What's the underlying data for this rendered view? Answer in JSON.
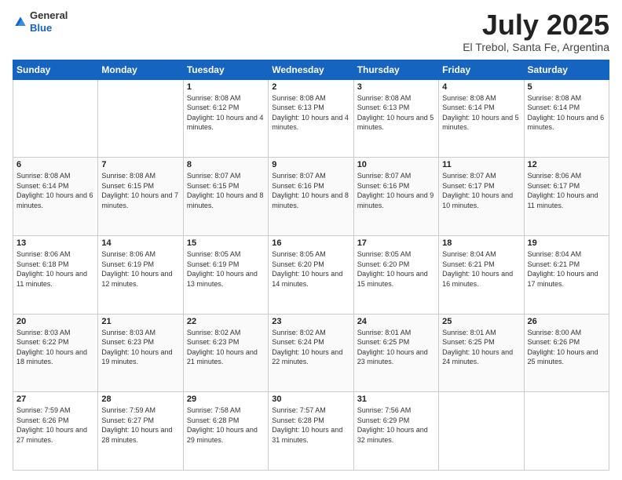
{
  "header": {
    "logo_line1": "General",
    "logo_line2": "Blue",
    "title": "July 2025",
    "location": "El Trebol, Santa Fe, Argentina"
  },
  "columns": [
    "Sunday",
    "Monday",
    "Tuesday",
    "Wednesday",
    "Thursday",
    "Friday",
    "Saturday"
  ],
  "weeks": [
    [
      {
        "day": "",
        "info": ""
      },
      {
        "day": "",
        "info": ""
      },
      {
        "day": "1",
        "info": "Sunrise: 8:08 AM\nSunset: 6:12 PM\nDaylight: 10 hours and 4 minutes."
      },
      {
        "day": "2",
        "info": "Sunrise: 8:08 AM\nSunset: 6:13 PM\nDaylight: 10 hours and 4 minutes."
      },
      {
        "day": "3",
        "info": "Sunrise: 8:08 AM\nSunset: 6:13 PM\nDaylight: 10 hours and 5 minutes."
      },
      {
        "day": "4",
        "info": "Sunrise: 8:08 AM\nSunset: 6:14 PM\nDaylight: 10 hours and 5 minutes."
      },
      {
        "day": "5",
        "info": "Sunrise: 8:08 AM\nSunset: 6:14 PM\nDaylight: 10 hours and 6 minutes."
      }
    ],
    [
      {
        "day": "6",
        "info": "Sunrise: 8:08 AM\nSunset: 6:14 PM\nDaylight: 10 hours and 6 minutes."
      },
      {
        "day": "7",
        "info": "Sunrise: 8:08 AM\nSunset: 6:15 PM\nDaylight: 10 hours and 7 minutes."
      },
      {
        "day": "8",
        "info": "Sunrise: 8:07 AM\nSunset: 6:15 PM\nDaylight: 10 hours and 8 minutes."
      },
      {
        "day": "9",
        "info": "Sunrise: 8:07 AM\nSunset: 6:16 PM\nDaylight: 10 hours and 8 minutes."
      },
      {
        "day": "10",
        "info": "Sunrise: 8:07 AM\nSunset: 6:16 PM\nDaylight: 10 hours and 9 minutes."
      },
      {
        "day": "11",
        "info": "Sunrise: 8:07 AM\nSunset: 6:17 PM\nDaylight: 10 hours and 10 minutes."
      },
      {
        "day": "12",
        "info": "Sunrise: 8:06 AM\nSunset: 6:17 PM\nDaylight: 10 hours and 11 minutes."
      }
    ],
    [
      {
        "day": "13",
        "info": "Sunrise: 8:06 AM\nSunset: 6:18 PM\nDaylight: 10 hours and 11 minutes."
      },
      {
        "day": "14",
        "info": "Sunrise: 8:06 AM\nSunset: 6:19 PM\nDaylight: 10 hours and 12 minutes."
      },
      {
        "day": "15",
        "info": "Sunrise: 8:05 AM\nSunset: 6:19 PM\nDaylight: 10 hours and 13 minutes."
      },
      {
        "day": "16",
        "info": "Sunrise: 8:05 AM\nSunset: 6:20 PM\nDaylight: 10 hours and 14 minutes."
      },
      {
        "day": "17",
        "info": "Sunrise: 8:05 AM\nSunset: 6:20 PM\nDaylight: 10 hours and 15 minutes."
      },
      {
        "day": "18",
        "info": "Sunrise: 8:04 AM\nSunset: 6:21 PM\nDaylight: 10 hours and 16 minutes."
      },
      {
        "day": "19",
        "info": "Sunrise: 8:04 AM\nSunset: 6:21 PM\nDaylight: 10 hours and 17 minutes."
      }
    ],
    [
      {
        "day": "20",
        "info": "Sunrise: 8:03 AM\nSunset: 6:22 PM\nDaylight: 10 hours and 18 minutes."
      },
      {
        "day": "21",
        "info": "Sunrise: 8:03 AM\nSunset: 6:23 PM\nDaylight: 10 hours and 19 minutes."
      },
      {
        "day": "22",
        "info": "Sunrise: 8:02 AM\nSunset: 6:23 PM\nDaylight: 10 hours and 21 minutes."
      },
      {
        "day": "23",
        "info": "Sunrise: 8:02 AM\nSunset: 6:24 PM\nDaylight: 10 hours and 22 minutes."
      },
      {
        "day": "24",
        "info": "Sunrise: 8:01 AM\nSunset: 6:25 PM\nDaylight: 10 hours and 23 minutes."
      },
      {
        "day": "25",
        "info": "Sunrise: 8:01 AM\nSunset: 6:25 PM\nDaylight: 10 hours and 24 minutes."
      },
      {
        "day": "26",
        "info": "Sunrise: 8:00 AM\nSunset: 6:26 PM\nDaylight: 10 hours and 25 minutes."
      }
    ],
    [
      {
        "day": "27",
        "info": "Sunrise: 7:59 AM\nSunset: 6:26 PM\nDaylight: 10 hours and 27 minutes."
      },
      {
        "day": "28",
        "info": "Sunrise: 7:59 AM\nSunset: 6:27 PM\nDaylight: 10 hours and 28 minutes."
      },
      {
        "day": "29",
        "info": "Sunrise: 7:58 AM\nSunset: 6:28 PM\nDaylight: 10 hours and 29 minutes."
      },
      {
        "day": "30",
        "info": "Sunrise: 7:57 AM\nSunset: 6:28 PM\nDaylight: 10 hours and 31 minutes."
      },
      {
        "day": "31",
        "info": "Sunrise: 7:56 AM\nSunset: 6:29 PM\nDaylight: 10 hours and 32 minutes."
      },
      {
        "day": "",
        "info": ""
      },
      {
        "day": "",
        "info": ""
      }
    ]
  ]
}
